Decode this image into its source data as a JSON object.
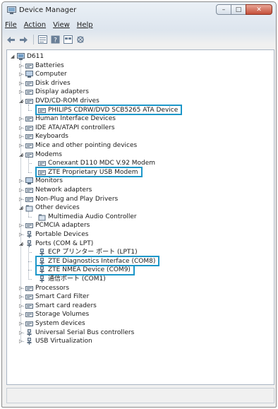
{
  "window": {
    "title": "Device Manager",
    "controls": {
      "minimize": "–",
      "maximize": "□",
      "close": "✕"
    }
  },
  "menu": [
    "File",
    "Action",
    "View",
    "Help"
  ],
  "toolbar": [
    "back-icon",
    "forward-icon",
    "properties-icon",
    "help-icon",
    "view-icon",
    "scan-icon"
  ],
  "tree": {
    "root": "D611",
    "categories": [
      {
        "label": "Batteries",
        "icon": "battery-icon",
        "expanded": false
      },
      {
        "label": "Computer",
        "icon": "computer-icon",
        "expanded": false
      },
      {
        "label": "Disk drives",
        "icon": "disk-drive-icon",
        "expanded": false
      },
      {
        "label": "Display adapters",
        "icon": "display-adapter-icon",
        "expanded": false
      },
      {
        "label": "DVD/CD-ROM drives",
        "icon": "dvd-drive-icon",
        "expanded": true,
        "children": [
          "PHILIPS CDRW/DVD SCB5265 ATA Device"
        ]
      },
      {
        "label": "Human Interface Devices",
        "icon": "hid-icon",
        "expanded": false
      },
      {
        "label": "IDE ATA/ATAPI controllers",
        "icon": "ide-controller-icon",
        "expanded": false
      },
      {
        "label": "Keyboards",
        "icon": "keyboard-icon",
        "expanded": false
      },
      {
        "label": "Mice and other pointing devices",
        "icon": "mouse-icon",
        "expanded": false
      },
      {
        "label": "Modems",
        "icon": "modem-icon",
        "expanded": true,
        "children": [
          "Conexant D110 MDC V.92 Modem",
          "ZTE Proprietary USB Modem"
        ]
      },
      {
        "label": "Monitors",
        "icon": "monitor-icon",
        "expanded": false
      },
      {
        "label": "Network adapters",
        "icon": "network-adapter-icon",
        "expanded": false
      },
      {
        "label": "Non-Plug and Play Drivers",
        "icon": "driver-icon",
        "expanded": false
      },
      {
        "label": "Other devices",
        "icon": "unknown-device-icon",
        "expanded": true,
        "children": [
          "Multimedia Audio Controller"
        ]
      },
      {
        "label": "PCMCIA adapters",
        "icon": "pcmcia-icon",
        "expanded": false
      },
      {
        "label": "Portable Devices",
        "icon": "portable-device-icon",
        "expanded": false
      },
      {
        "label": "Ports (COM & LPT)",
        "icon": "port-icon",
        "expanded": true,
        "children": [
          "ECP プリンター ポート (LPT1)",
          "ZTE Diagnostics Interface (COM8)",
          "ZTE NMEA Device (COM9)",
          "通信ポート (COM1)"
        ]
      },
      {
        "label": "Processors",
        "icon": "processor-icon",
        "expanded": false
      },
      {
        "label": "Smart Card Filter",
        "icon": "smart-card-icon",
        "expanded": false
      },
      {
        "label": "Smart card readers",
        "icon": "smart-card-reader-icon",
        "expanded": false
      },
      {
        "label": "Storage Volumes",
        "icon": "storage-volume-icon",
        "expanded": false
      },
      {
        "label": "System devices",
        "icon": "system-device-icon",
        "expanded": false
      },
      {
        "label": "Universal Serial Bus controllers",
        "icon": "usb-icon",
        "expanded": false
      },
      {
        "label": "USB Virtualization",
        "icon": "usb-virtualization-icon",
        "expanded": false
      }
    ]
  },
  "highlighted": [
    "PHILIPS CDRW/DVD SCB5265 ATA Device",
    "ZTE Proprietary USB Modem",
    "ZTE Diagnostics Interface (COM8)",
    "ZTE NMEA Device (COM9)"
  ],
  "colors": {
    "highlight_border": "#1d97c9",
    "tree_bg": "#ffffff",
    "chrome_bg": "#f0f0f0"
  }
}
